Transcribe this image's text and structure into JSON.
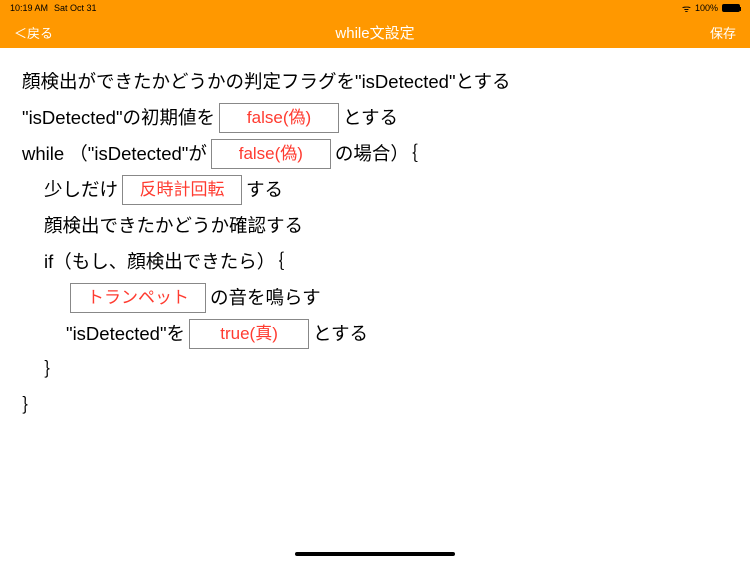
{
  "status": {
    "time": "10:19 AM",
    "date": "Sat Oct 31",
    "battery": "100%"
  },
  "nav": {
    "back": "戻る",
    "title": "while文設定",
    "save": "保存"
  },
  "content": {
    "line1": "顔検出ができたかどうかの判定フラグを\"isDetected\"とする",
    "line2_a": "\"isDetected\"の初期値を",
    "line2_b": "とする",
    "line3_a": "while （\"isDetected\"が",
    "line3_b": "の場合）｛",
    "line4_a": "少しだけ",
    "line4_b": "する",
    "line5": "顔検出できたかどうか確認する",
    "line6": "if（もし、顔検出できたら）｛",
    "line7_b": "の音を鳴らす",
    "line8_a": "\"isDetected\"を",
    "line8_b": "とする",
    "line9": "｝",
    "line10": "｝"
  },
  "dropdowns": {
    "initial_value": "false(偽)",
    "while_condition": "false(偽)",
    "rotation": "反時計回転",
    "sound": "トランペット",
    "set_value": "true(真)"
  }
}
